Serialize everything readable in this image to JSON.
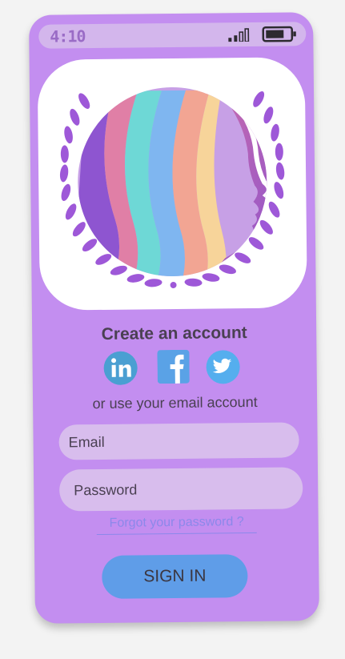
{
  "status_bar": {
    "time": "4:10",
    "signal_icon": "signal-bars-icon",
    "battery_icon": "battery-icon"
  },
  "logo": {
    "icon": "woman-profile-rainbow-hair-laurel-logo",
    "colors": [
      "#9c5fd6",
      "#e37fa4",
      "#7fb6f0",
      "#f2a593",
      "#6ed8d6",
      "#f7d49a"
    ]
  },
  "signup": {
    "title": "Create an account",
    "alt_text": "or use your email account"
  },
  "social": {
    "linkedin_icon": "linkedin-icon",
    "facebook_icon": "facebook-icon",
    "twitter_icon": "twitter-icon",
    "colors": {
      "linkedin": "#4a9fd2",
      "facebook": "#5aa2e6",
      "twitter": "#55aeee"
    }
  },
  "form": {
    "email_placeholder": "Email",
    "password_placeholder": "Password",
    "forgot_label": "Forgot your password ?",
    "submit_label": "SIGN IN"
  },
  "theme": {
    "card_bg": "#c38ef0",
    "field_bg": "#d8bded",
    "button_bg": "#5f9de8",
    "link_color": "#8c88ea"
  }
}
